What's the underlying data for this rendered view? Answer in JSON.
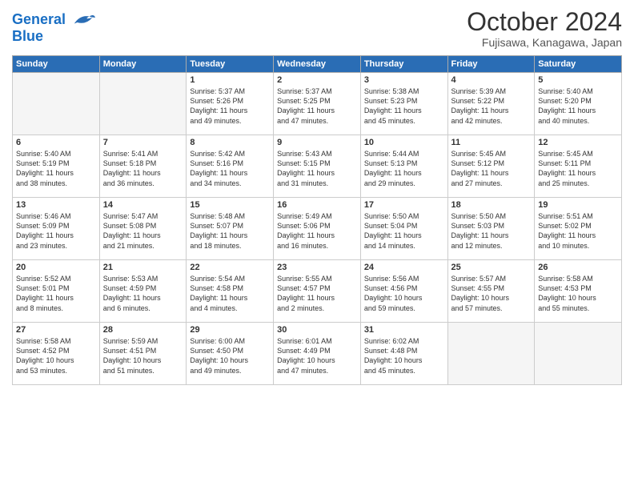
{
  "header": {
    "logo_line1": "General",
    "logo_line2": "Blue",
    "month": "October 2024",
    "location": "Fujisawa, Kanagawa, Japan"
  },
  "weekdays": [
    "Sunday",
    "Monday",
    "Tuesday",
    "Wednesday",
    "Thursday",
    "Friday",
    "Saturday"
  ],
  "weeks": [
    [
      {
        "day": "",
        "text": ""
      },
      {
        "day": "",
        "text": ""
      },
      {
        "day": "1",
        "text": "Sunrise: 5:37 AM\nSunset: 5:26 PM\nDaylight: 11 hours\nand 49 minutes."
      },
      {
        "day": "2",
        "text": "Sunrise: 5:37 AM\nSunset: 5:25 PM\nDaylight: 11 hours\nand 47 minutes."
      },
      {
        "day": "3",
        "text": "Sunrise: 5:38 AM\nSunset: 5:23 PM\nDaylight: 11 hours\nand 45 minutes."
      },
      {
        "day": "4",
        "text": "Sunrise: 5:39 AM\nSunset: 5:22 PM\nDaylight: 11 hours\nand 42 minutes."
      },
      {
        "day": "5",
        "text": "Sunrise: 5:40 AM\nSunset: 5:20 PM\nDaylight: 11 hours\nand 40 minutes."
      }
    ],
    [
      {
        "day": "6",
        "text": "Sunrise: 5:40 AM\nSunset: 5:19 PM\nDaylight: 11 hours\nand 38 minutes."
      },
      {
        "day": "7",
        "text": "Sunrise: 5:41 AM\nSunset: 5:18 PM\nDaylight: 11 hours\nand 36 minutes."
      },
      {
        "day": "8",
        "text": "Sunrise: 5:42 AM\nSunset: 5:16 PM\nDaylight: 11 hours\nand 34 minutes."
      },
      {
        "day": "9",
        "text": "Sunrise: 5:43 AM\nSunset: 5:15 PM\nDaylight: 11 hours\nand 31 minutes."
      },
      {
        "day": "10",
        "text": "Sunrise: 5:44 AM\nSunset: 5:13 PM\nDaylight: 11 hours\nand 29 minutes."
      },
      {
        "day": "11",
        "text": "Sunrise: 5:45 AM\nSunset: 5:12 PM\nDaylight: 11 hours\nand 27 minutes."
      },
      {
        "day": "12",
        "text": "Sunrise: 5:45 AM\nSunset: 5:11 PM\nDaylight: 11 hours\nand 25 minutes."
      }
    ],
    [
      {
        "day": "13",
        "text": "Sunrise: 5:46 AM\nSunset: 5:09 PM\nDaylight: 11 hours\nand 23 minutes."
      },
      {
        "day": "14",
        "text": "Sunrise: 5:47 AM\nSunset: 5:08 PM\nDaylight: 11 hours\nand 21 minutes."
      },
      {
        "day": "15",
        "text": "Sunrise: 5:48 AM\nSunset: 5:07 PM\nDaylight: 11 hours\nand 18 minutes."
      },
      {
        "day": "16",
        "text": "Sunrise: 5:49 AM\nSunset: 5:06 PM\nDaylight: 11 hours\nand 16 minutes."
      },
      {
        "day": "17",
        "text": "Sunrise: 5:50 AM\nSunset: 5:04 PM\nDaylight: 11 hours\nand 14 minutes."
      },
      {
        "day": "18",
        "text": "Sunrise: 5:50 AM\nSunset: 5:03 PM\nDaylight: 11 hours\nand 12 minutes."
      },
      {
        "day": "19",
        "text": "Sunrise: 5:51 AM\nSunset: 5:02 PM\nDaylight: 11 hours\nand 10 minutes."
      }
    ],
    [
      {
        "day": "20",
        "text": "Sunrise: 5:52 AM\nSunset: 5:01 PM\nDaylight: 11 hours\nand 8 minutes."
      },
      {
        "day": "21",
        "text": "Sunrise: 5:53 AM\nSunset: 4:59 PM\nDaylight: 11 hours\nand 6 minutes."
      },
      {
        "day": "22",
        "text": "Sunrise: 5:54 AM\nSunset: 4:58 PM\nDaylight: 11 hours\nand 4 minutes."
      },
      {
        "day": "23",
        "text": "Sunrise: 5:55 AM\nSunset: 4:57 PM\nDaylight: 11 hours\nand 2 minutes."
      },
      {
        "day": "24",
        "text": "Sunrise: 5:56 AM\nSunset: 4:56 PM\nDaylight: 10 hours\nand 59 minutes."
      },
      {
        "day": "25",
        "text": "Sunrise: 5:57 AM\nSunset: 4:55 PM\nDaylight: 10 hours\nand 57 minutes."
      },
      {
        "day": "26",
        "text": "Sunrise: 5:58 AM\nSunset: 4:53 PM\nDaylight: 10 hours\nand 55 minutes."
      }
    ],
    [
      {
        "day": "27",
        "text": "Sunrise: 5:58 AM\nSunset: 4:52 PM\nDaylight: 10 hours\nand 53 minutes."
      },
      {
        "day": "28",
        "text": "Sunrise: 5:59 AM\nSunset: 4:51 PM\nDaylight: 10 hours\nand 51 minutes."
      },
      {
        "day": "29",
        "text": "Sunrise: 6:00 AM\nSunset: 4:50 PM\nDaylight: 10 hours\nand 49 minutes."
      },
      {
        "day": "30",
        "text": "Sunrise: 6:01 AM\nSunset: 4:49 PM\nDaylight: 10 hours\nand 47 minutes."
      },
      {
        "day": "31",
        "text": "Sunrise: 6:02 AM\nSunset: 4:48 PM\nDaylight: 10 hours\nand 45 minutes."
      },
      {
        "day": "",
        "text": ""
      },
      {
        "day": "",
        "text": ""
      }
    ]
  ]
}
